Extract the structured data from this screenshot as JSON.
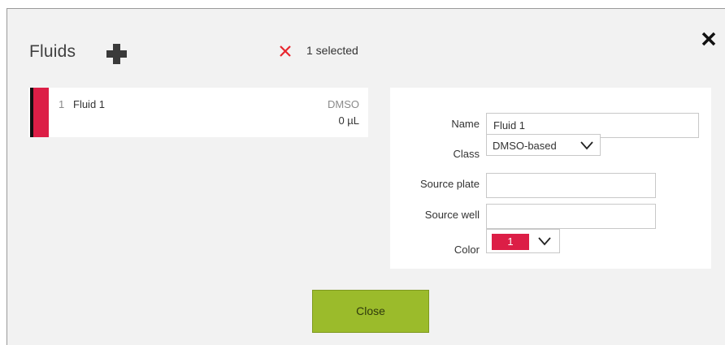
{
  "header": {
    "title": "Fluids",
    "add_icon": "plus-icon",
    "clear_icon": "x-icon",
    "selected_text": "1 selected",
    "close_icon": "close-icon"
  },
  "fluids": [
    {
      "number": "1",
      "name": "Fluid 1",
      "class": "DMSO",
      "volume": "0 µL",
      "color": "#dc1e46"
    }
  ],
  "properties": {
    "name_label": "Name",
    "name_value": "Fluid 1",
    "class_label": "Class",
    "class_value": "DMSO-based",
    "source_plate_label": "Source plate",
    "source_plate_value": "",
    "source_well_label": "Source well",
    "source_well_value": "",
    "color_label": "Color",
    "color_value": "1",
    "color_hex": "#dc1e46"
  },
  "footer": {
    "close_label": "Close"
  },
  "colors": {
    "accent_green": "#9bbb2b",
    "fluid_red": "#dc1e46",
    "clear_red": "#e8262e"
  }
}
